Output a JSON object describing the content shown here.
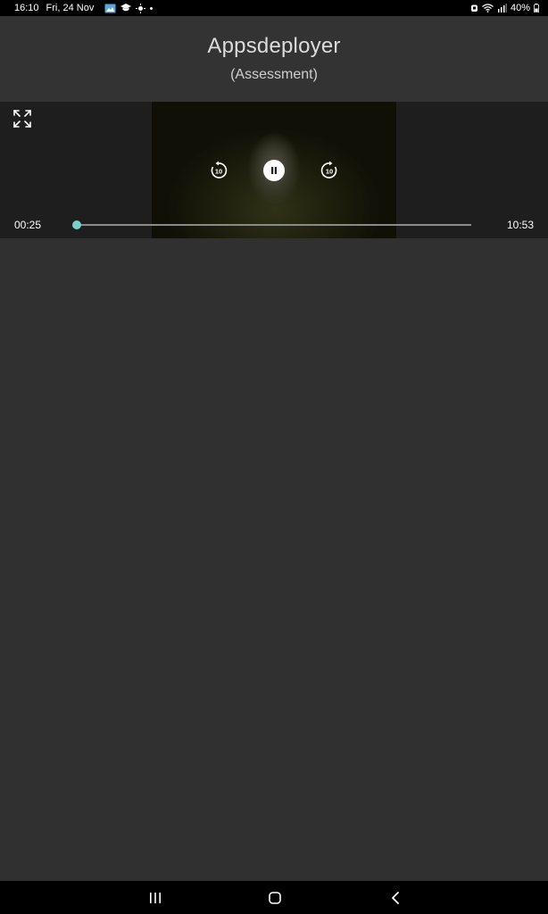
{
  "status_bar": {
    "time": "16:10",
    "date": "Fri, 24 Nov",
    "battery": "40%",
    "icons": [
      "gallery-icon",
      "education-icon",
      "sun-icon",
      "dot-icon",
      "alarm-icon",
      "wifi-icon",
      "signal-icon",
      "battery-icon"
    ]
  },
  "header": {
    "title": "Appsdeployer",
    "subtitle": "(Assessment)"
  },
  "player": {
    "current_time": "00:25",
    "total_time": "10:53",
    "progress_fraction": 0.0,
    "rewind_seconds": "10",
    "forward_seconds": "10",
    "state": "playing",
    "accent_color": "#69c5c0"
  },
  "nav_bar": {
    "buttons": [
      "recents-icon",
      "home-icon",
      "back-icon"
    ]
  }
}
